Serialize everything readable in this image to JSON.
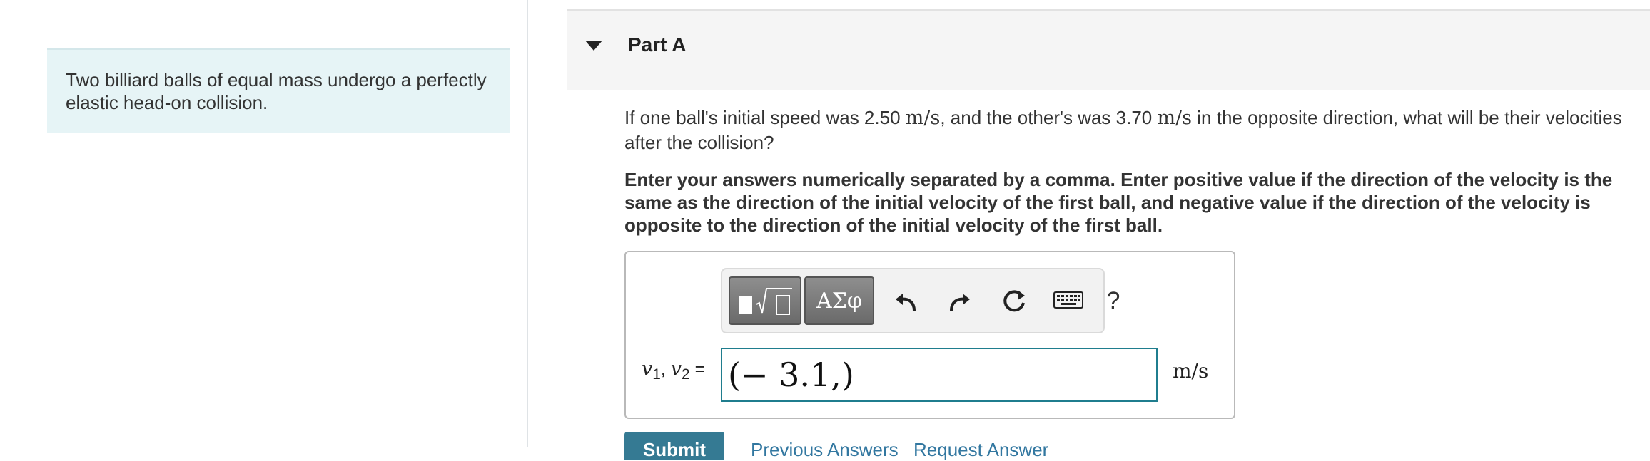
{
  "intro": {
    "text": "Two billiard balls of equal mass undergo a perfectly elastic head-on collision."
  },
  "part": {
    "title": "Part A"
  },
  "question": {
    "text_1": "If one ball's initial speed was 2.50 ",
    "unit_1": "m/s",
    "text_2": ", and the other's was 3.70 ",
    "unit_2": "m/s",
    "text_3": " in the opposite direction, what will be their velocities after the collision?"
  },
  "instructions": "Enter your answers numerically separated by a comma. Enter positive value if the direction of the velocity is the same as the direction of the initial velocity of the first ball, and negative value if the direction of the velocity is opposite to the direction of the initial velocity of the first ball.",
  "toolbar": {
    "greek_label": "ΑΣφ",
    "help_label": "?",
    "icons": [
      "templates-icon",
      "greek-symbols-icon",
      "undo-icon",
      "redo-icon",
      "reset-icon",
      "keyboard-icon",
      "help-icon"
    ]
  },
  "answer": {
    "lhs_v1": "v",
    "lhs_sub1": "1",
    "lhs_sep": ", ",
    "lhs_v2": "v",
    "lhs_sub2": "2",
    "lhs_eq": " =",
    "value": "(− 3.1,)",
    "units": "m/s"
  },
  "actions": {
    "submit_label": "Submit",
    "previous_answers_label": "Previous Answers",
    "request_answer_label": "Request Answer"
  },
  "colors": {
    "intro_bg": "#e6f4f6",
    "input_border": "#1f7d8e",
    "submit_bg": "#357a93",
    "link": "#3277a0"
  }
}
